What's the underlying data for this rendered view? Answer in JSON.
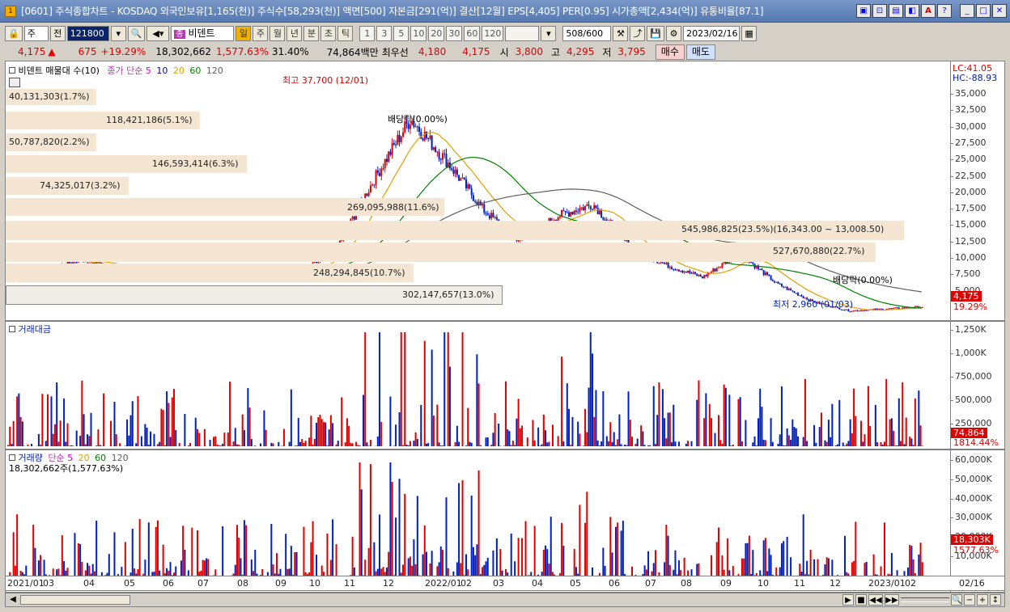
{
  "titlebar": {
    "app_icon": "1",
    "title": "[0601] 주식종합차트 - KOSDAQ 외국인보유[1,165(천)] 주식수[58,293(천)] 액면[500] 자본금[291(억)] 결산[12월] EPS[4,405] PER[0.95] 시가총액[2,434(억)] 유통비율[87.1]",
    "buttons": [
      "window-icon",
      "restore-icon",
      "copy-icon",
      "tile-icon",
      "a-icon",
      "help-icon",
      "minimize-icon",
      "maximize-icon",
      "close-icon"
    ],
    "button_glyphs": [
      "▣",
      "⊡",
      "▤",
      "◧",
      "A",
      "?",
      "_",
      "□",
      "✕"
    ]
  },
  "toolbar": {
    "market": "주",
    "prev_label": "전",
    "code": "121800",
    "stock_name": "비덴트",
    "periods": [
      "일",
      "주",
      "월",
      "년",
      "분",
      "초",
      "틱"
    ],
    "selected_period": "일",
    "intervals": [
      "1",
      "3",
      "5",
      "10",
      "20",
      "30",
      "60",
      "120"
    ],
    "count": "508",
    "count_total": "/600",
    "date": "2023/02/16"
  },
  "quote": {
    "price": "4,175",
    "change_arrow": "▲",
    "change": "675",
    "change_pct": "+19.29%",
    "volume": "18,302,662",
    "volume_pct": "1,577.63%",
    "turnover_pct": "31.40%",
    "amount": "74,864백만",
    "best_quote_label": "최우선",
    "best_ask": "4,180",
    "best_bid": "4,175",
    "open_label": "시",
    "open": "3,800",
    "high_label": "고",
    "high": "4,295",
    "low_label": "저",
    "low": "3,795",
    "buy_label": "매수",
    "sell_label": "매도"
  },
  "price_pane": {
    "legend_title": "비덴트 매물대 수(10)",
    "ma_label": "종가 단순",
    "ma_periods": [
      "5",
      "10",
      "20",
      "60",
      "120"
    ],
    "ma_colors": [
      "#e000e0",
      "#0000c0",
      "#e0a000",
      "#008000",
      "#606060"
    ],
    "lc": "LC:41.05",
    "hc": "HC:-88.93",
    "y_ticks": [
      "35,000",
      "32,500",
      "30,000",
      "27,500",
      "25,000",
      "22,500",
      "20,000",
      "17,500",
      "15,000",
      "12,500",
      "10,000",
      "7,500",
      "5,000"
    ],
    "current_price_tag": "4,175",
    "current_pct_tag": "19.29%",
    "high_annotation": "최고 37,700 (12/01)",
    "low_annotation": "최저 2,960 (01/03)",
    "dividend1": "배당락(0.00%)",
    "dividend2": "배당락(0.00%)",
    "volume_profile": [
      {
        "label": "40,131,303(1.7%)"
      },
      {
        "label": "118,421,186(5.1%)"
      },
      {
        "label": "50,787,820(2.2%)"
      },
      {
        "label": "146,593,414(6.3%)"
      },
      {
        "label": "74,325,017(3.2%)"
      },
      {
        "label": "269,095,988(11.6%)"
      },
      {
        "label": "545,986,825(23.5%)(16,343.00 ~ 13,008.50)"
      },
      {
        "label": "527,670,880(22.7%)"
      },
      {
        "label": "248,294,845(10.7%)"
      },
      {
        "label": "302,147,657(13.0%)"
      }
    ]
  },
  "amount_pane": {
    "legend": "거래대금",
    "y_ticks": [
      "1,250K",
      "1,000K",
      "750,000",
      "500,000",
      "250,000"
    ],
    "tag_value": "74,864",
    "tag_pct": "1814.44%"
  },
  "volume_pane": {
    "legend_label": "거래량",
    "legend_ma": "단순",
    "ma_periods": [
      "5",
      "20",
      "60",
      "120"
    ],
    "current": "18,302,662주(1,577.63%)",
    "y_ticks": [
      "60,000K",
      "50,000K",
      "40,000K",
      "30,000K",
      "20,000K",
      "10,000K"
    ],
    "tag_value": "18,303K",
    "tag_pct": "1577.63%"
  },
  "x_axis": {
    "labels": [
      "2021/01",
      "03",
      "04",
      "05",
      "06",
      "07",
      "08",
      "09",
      "10",
      "11",
      "12",
      "2022/01",
      "02",
      "03",
      "04",
      "05",
      "06",
      "07",
      "08",
      "09",
      "10",
      "11",
      "12",
      "2023/01",
      "02"
    ],
    "end_label": "02/16"
  },
  "scroll_controls": [
    "▶",
    "■",
    "◀◀",
    "▶▶"
  ],
  "chart_data": [
    {
      "type": "line",
      "title": "비덴트",
      "series": [
        {
          "name": "종가",
          "values": [
            8500,
            10000,
            12000,
            10500,
            9000,
            8800,
            10500,
            10200,
            9500,
            14000,
            25000,
            35000,
            28000,
            20000,
            15000,
            19000,
            21000,
            14000,
            11000,
            9000,
            13000,
            8000,
            5000,
            3500,
            3800,
            4175
          ]
        }
      ],
      "ylim": [
        2500,
        37500
      ],
      "y_ticks": [
        5000,
        7500,
        10000,
        12500,
        15000,
        17500,
        20000,
        22500,
        25000,
        27500,
        30000,
        32500,
        35000
      ]
    },
    {
      "type": "bar",
      "title": "거래대금",
      "ylim": [
        0,
        1300000
      ]
    },
    {
      "type": "bar",
      "title": "거래량",
      "ylim": [
        0,
        62000
      ]
    }
  ]
}
